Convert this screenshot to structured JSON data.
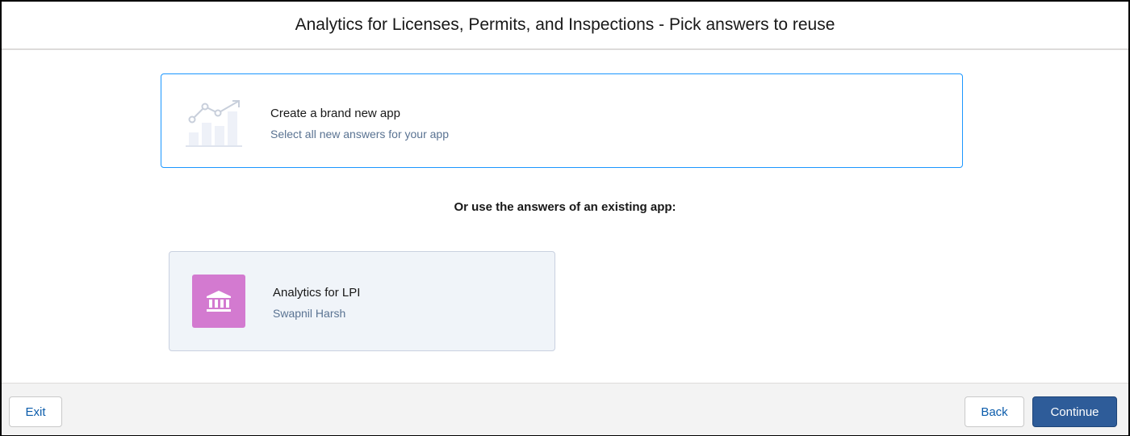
{
  "header": {
    "title": "Analytics for Licenses, Permits, and Inspections - Pick answers to reuse"
  },
  "new_app_card": {
    "title": "Create a brand new app",
    "subtitle": "Select all new answers for your app",
    "icon": "chart-illustration-icon"
  },
  "divider_text": "Or use the answers of an existing app:",
  "existing_apps": [
    {
      "name": "Analytics for LPI",
      "owner": "Swapnil Harsh",
      "icon": "bank-icon",
      "icon_color": "#d37ad0"
    }
  ],
  "footer": {
    "exit_label": "Exit",
    "back_label": "Back",
    "continue_label": "Continue"
  },
  "colors": {
    "accent_border": "#1b96ff",
    "brand_button": "#2e5c99",
    "subtitle_text": "#5a7392"
  }
}
